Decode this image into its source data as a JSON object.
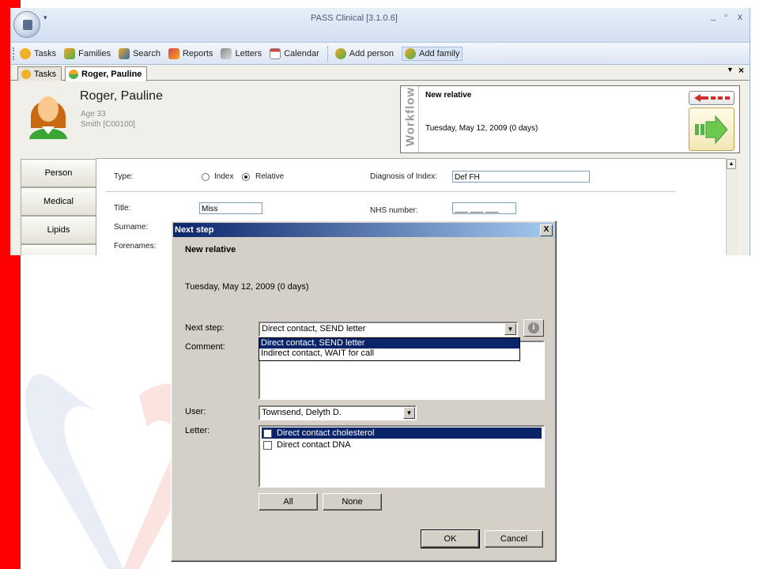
{
  "window": {
    "title": "PASS Clinical [3.1.0.6]",
    "min_glyph": "_",
    "restore_glyph": "▫",
    "close_glyph": "x"
  },
  "toolbar": {
    "items": [
      {
        "label": "Tasks",
        "icon": "tasks-icon"
      },
      {
        "label": "Families",
        "icon": "families-icon"
      },
      {
        "label": "Search",
        "icon": "search-icon"
      },
      {
        "label": "Reports",
        "icon": "reports-icon"
      },
      {
        "label": "Letters",
        "icon": "letters-icon"
      },
      {
        "label": "Calendar",
        "icon": "calendar-icon"
      },
      {
        "label": "Add person",
        "icon": "add-person-icon"
      },
      {
        "label": "Add family",
        "icon": "add-family-icon"
      }
    ]
  },
  "tabs": [
    {
      "label": "Tasks",
      "active": false
    },
    {
      "label": "Roger, Pauline",
      "active": true
    }
  ],
  "patient": {
    "name": "Roger, Pauline",
    "age": "Age 33",
    "id": "Smith [C00100]"
  },
  "workflow": {
    "label": "Workflow",
    "step": "New relative",
    "date": "Tuesday, May 12, 2009 (0 days)"
  },
  "nav": [
    "Person",
    "Medical",
    "Lipids"
  ],
  "form": {
    "type_label": "Type:",
    "type_options": [
      "Index",
      "Relative"
    ],
    "type_selected": "Relative",
    "diagnosis_label": "Diagnosis of Index:",
    "diagnosis_value": "Def FH",
    "title_label": "Title:",
    "title_value": "Miss",
    "nhs_label": "NHS number:",
    "nhs_value": "___ ___ ___",
    "surname_label": "Surname:",
    "forenames_label": "Forenames:"
  },
  "dialog": {
    "title": "Next step",
    "close_glyph": "X",
    "step": "New relative",
    "date": "Tuesday, May 12, 2009 (0 days)",
    "next_step_label": "Next step:",
    "next_step_value": "Direct contact, SEND letter",
    "next_step_options": [
      "Direct contact, SEND letter",
      "Indirect contact, WAIT for call"
    ],
    "comment_label": "Comment:",
    "user_label": "User:",
    "user_value": "Townsend, Delyth D.",
    "letter_label": "Letter:",
    "letters": [
      {
        "label": "Direct contact cholesterol",
        "selected": true
      },
      {
        "label": "Direct contact DNA",
        "selected": false
      }
    ],
    "all_button": "All",
    "none_button": "None",
    "ok_button": "OK",
    "cancel_button": "Cancel",
    "info_glyph": "i"
  }
}
